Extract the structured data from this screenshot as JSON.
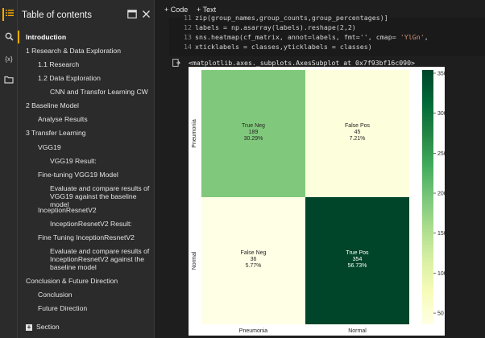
{
  "sidebar": {
    "title": "Table of contents",
    "icons": [
      "toc-icon",
      "search-icon",
      "variables-icon",
      "folder-icon"
    ],
    "variables_glyph": "{x}",
    "items": [
      {
        "label": "Introduction",
        "active": true
      },
      {
        "label": "1 Research & Data Exploration"
      },
      {
        "label": "1.1 Research"
      },
      {
        "label": "1.2 Data Exploration"
      },
      {
        "label": "CNN and Transfor Learning CW"
      },
      {
        "label": "2 Baseline Model"
      },
      {
        "label": "Analyse Results"
      },
      {
        "label": "3 Transfer Learning"
      },
      {
        "label": "VGG19"
      },
      {
        "label": "VGG19 Result:"
      },
      {
        "label": "Fine-tuning VGG19 Model"
      },
      {
        "label": "Evaluate and compare results of VGG19 against the baseline model"
      },
      {
        "label": "InceptionResnetV2"
      },
      {
        "label": "InceptionResnetV2 Result:"
      },
      {
        "label": "Fine Tuning InceptionResnetV2"
      },
      {
        "label": "Evaluate and compare results of InceptionResnetV2 against the baseline model"
      },
      {
        "label": "Conclusion & Future Direction"
      },
      {
        "label": "Conclusion"
      },
      {
        "label": "Future Direction"
      },
      {
        "label": "Section"
      }
    ]
  },
  "toolbar": {
    "code_label": "+ Code",
    "text_label": "+ Text"
  },
  "code_lines": [
    {
      "num": "11",
      "text": "zip(group_names,group_counts,group_percentages)]"
    },
    {
      "num": "12",
      "text": "labels = np.asarray(labels).reshape(2,2)"
    },
    {
      "num": "13",
      "pre": "sns.heatmap(cf_matrix, annot=labels, fmt='', cmap= ",
      "str": "'YlGn'",
      "post": ","
    },
    {
      "num": "14",
      "text": "xticklabels = classes,yticklabels = classes)"
    }
  ],
  "output_text": "<matplotlib.axes._subplots.AxesSubplot at 0x7f93bf16c090>",
  "colors": {
    "accent": "#f9ab00",
    "sidebar_bg": "#2b2b2b",
    "main_bg": "#1e1e1e",
    "string": "#ce9178"
  },
  "chart_data": {
    "type": "heatmap",
    "x_categories": [
      "Pneumonia",
      "Normal"
    ],
    "y_categories": [
      "Pneumonia",
      "Normal"
    ],
    "cells": [
      {
        "row": 0,
        "col": 0,
        "value": 189,
        "name": "True Neg",
        "count": "189",
        "pct": "30.29%"
      },
      {
        "row": 0,
        "col": 1,
        "value": 45,
        "name": "False Pos",
        "count": "45",
        "pct": "7.21%"
      },
      {
        "row": 1,
        "col": 0,
        "value": 36,
        "name": "False Neg",
        "count": "36",
        "pct": "5.77%"
      },
      {
        "row": 1,
        "col": 1,
        "value": 354,
        "name": "True Pos",
        "count": "354",
        "pct": "56.73%"
      }
    ],
    "colormap": "YlGn",
    "colorbar_ticks": [
      50,
      100,
      150,
      200,
      250,
      300,
      350
    ],
    "vmin": 36,
    "vmax": 354
  }
}
